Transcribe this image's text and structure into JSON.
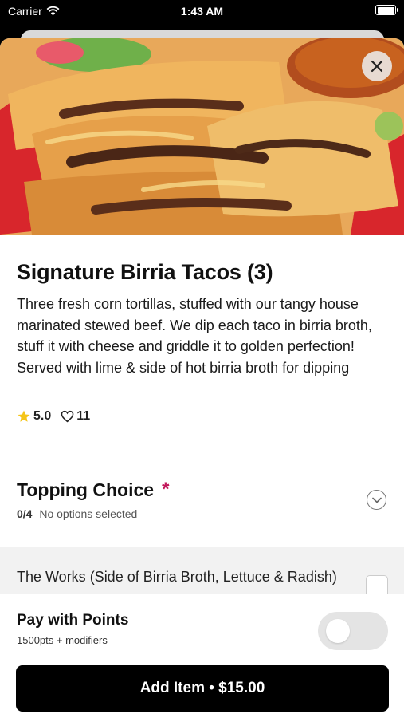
{
  "status_bar": {
    "carrier": "Carrier",
    "time": "1:43 AM",
    "wifi_icon": "wifi-icon",
    "battery_icon": "battery-icon"
  },
  "item": {
    "title": "Signature Birria Tacos (3)",
    "description": "Three fresh corn tortillas, stuffed with our tangy house marinated stewed beef. We dip each taco in birria broth, stuff it with cheese and griddle it to golden perfection! Served with lime & side of hot birria broth for dipping",
    "rating": "5.0",
    "likes": "11",
    "image_icon": "tacos-photo"
  },
  "topping": {
    "title": "Topping Choice",
    "required_marker": "*",
    "count": "0/4",
    "status": "No options selected",
    "option_label": "The Works (Side of Birria Broth, Lettuce & Radish)"
  },
  "points": {
    "title": "Pay with Points",
    "subtitle": "1500pts + modifiers",
    "enabled": false
  },
  "add_button": {
    "label": "Add Item • $15.00"
  },
  "colors": {
    "accent": "#c2185b",
    "star": "#f5c518",
    "button": "#000000"
  }
}
